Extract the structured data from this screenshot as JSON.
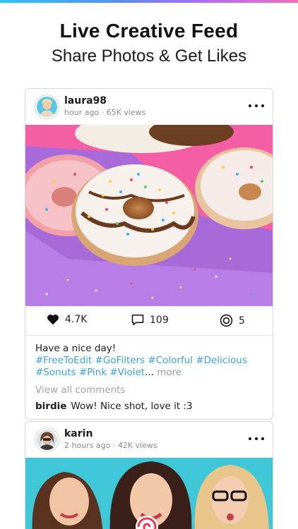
{
  "hero": {
    "title": "Live Creative Feed",
    "subtitle": "Share Photos & Get Likes"
  },
  "colors": {
    "accent_strip": [
      "#2ec5f1",
      "#b46cf0",
      "#f06fb5"
    ],
    "hashtag": "#3aa1dd",
    "muted": "#8a8a8a"
  },
  "posts": [
    {
      "username": "laura98",
      "meta": "hour ago · 65K views",
      "menu_icon": "more-dots-icon",
      "image": "donuts-photo",
      "likes": "4.7K",
      "comments": "109",
      "views": "5",
      "caption": "Have a nice day!",
      "tags_line1": [
        "#FreeToEdit",
        "#GoFilters",
        "#Colorful",
        "#Delicious"
      ],
      "tags_line2": [
        "#Sonuts",
        "#Pink",
        "#Violet"
      ],
      "tags_ellipsis": "...",
      "more_label": "more",
      "view_all_label": "View all comments",
      "top_comment": {
        "author": "birdie",
        "text": "Wow! Nice shot, love it :3"
      }
    },
    {
      "username": "karin",
      "meta": "2 hours ago · 42K views",
      "menu_icon": "more-dots-icon",
      "image": "friends-selfie-photo"
    }
  ]
}
